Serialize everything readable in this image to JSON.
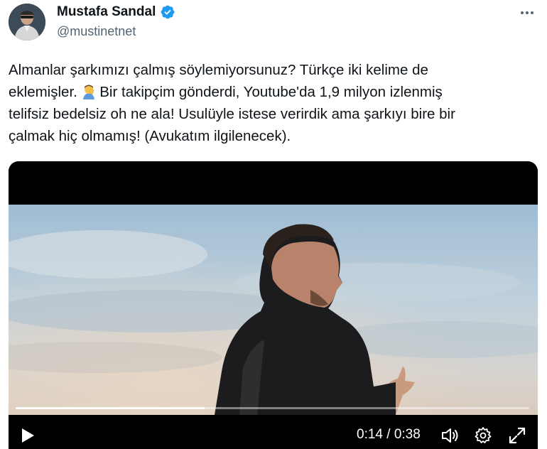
{
  "author": {
    "display_name": "Mustafa Sandal",
    "handle": "@mustinetnet",
    "verified": true,
    "verified_color": "#1d9bf0"
  },
  "menu": {
    "icon": "more-horizontal-icon"
  },
  "tweet": {
    "text_lines": [
      "Almanlar şarkımızı çalmış söylemiyorsunuz?  Türkçe iki kelime de",
      "eklemişler.",
      " Bir takipçim gönderdi, Youtube'da 1,9 milyon izlenmiş",
      "telifsiz bedelsiz oh ne ala! Usulüyle istese verirdik ama şarkıyı bire bir",
      "çalmak hiç olmamış! (Avukatım ilgilenecek)."
    ],
    "emoji": "man-facepalming-emoji"
  },
  "video": {
    "current_time": "0:14",
    "duration": "0:38",
    "time_display": "0:14 / 0:38",
    "progress": 0.3684,
    "controls": {
      "play": "play-icon",
      "volume": "volume-icon",
      "settings": "settings-gear-icon",
      "fullscreen": "fullscreen-expand-icon"
    }
  }
}
